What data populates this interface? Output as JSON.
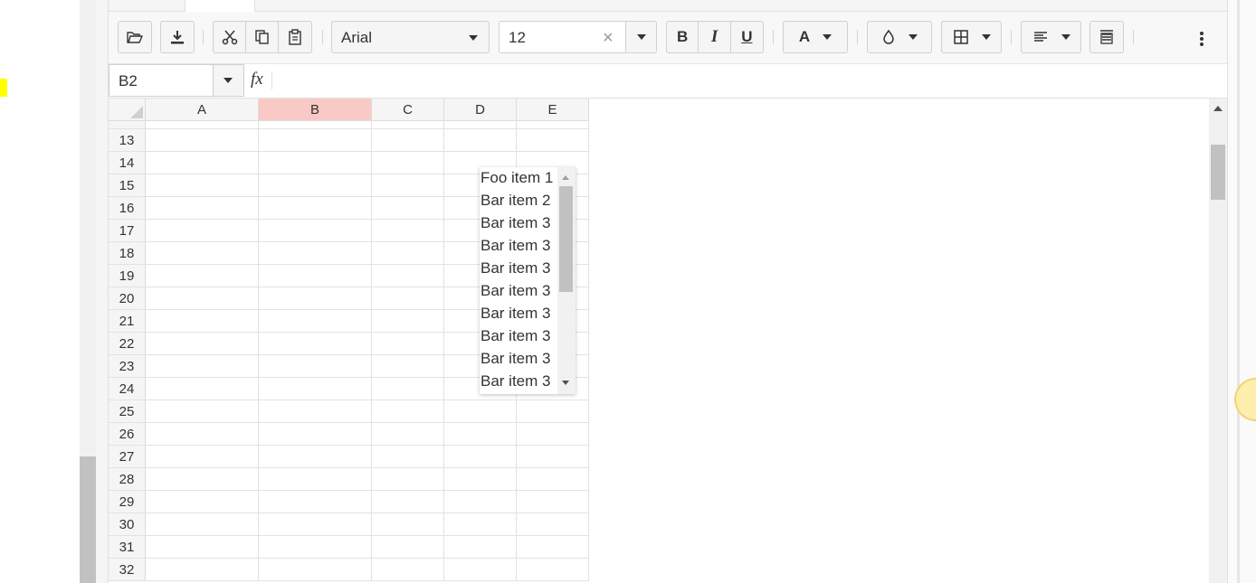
{
  "toolbar": {
    "font_family": "Arial",
    "font_size": "12",
    "bold_label": "B",
    "italic_label": "I",
    "underline_label": "U",
    "font_color_label": "A",
    "clear_icon": "×"
  },
  "formula_bar": {
    "cell_ref": "B2",
    "fx_label": "fx",
    "formula": ""
  },
  "grid": {
    "columns": [
      "A",
      "B",
      "C",
      "D",
      "E"
    ],
    "selected_column": "B",
    "rows": [
      "13",
      "14",
      "15",
      "16",
      "17",
      "18",
      "19",
      "20",
      "21",
      "22",
      "23",
      "24",
      "25",
      "26",
      "27",
      "28",
      "29",
      "30",
      "31",
      "32"
    ]
  },
  "dropdown": {
    "items": [
      "Foo item 1",
      "Bar item 2",
      "Bar item 3",
      "Bar item 3",
      "Bar item 3",
      "Bar item 3",
      "Bar item 3",
      "Bar item 3",
      "Bar item 3",
      "Bar item 3"
    ]
  },
  "icons": {
    "open": "folder-open-icon",
    "download": "download-icon",
    "cut": "scissors-icon",
    "copy": "copy-icon",
    "paste": "clipboard-icon",
    "fill_color": "droplet-icon",
    "borders": "grid-borders-icon",
    "align": "align-left-icon",
    "wrap": "wrap-text-icon",
    "more": "more-vertical-icon"
  },
  "colors": {
    "selected_column_header": "#f9c9c5",
    "highlight_marker": "#ffff00"
  }
}
